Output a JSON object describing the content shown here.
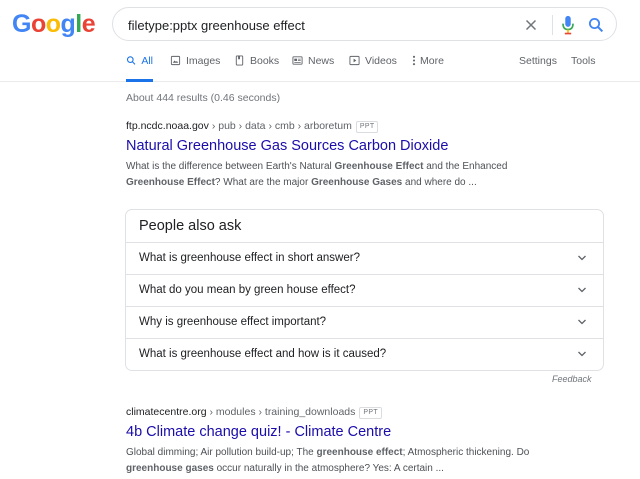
{
  "logo": {
    "text": "Google"
  },
  "search": {
    "query": "filetype:pptx greenhouse effect"
  },
  "tabs": [
    {
      "label": "All",
      "icon": "search-icon"
    },
    {
      "label": "Images",
      "icon": "image-icon"
    },
    {
      "label": "Books",
      "icon": "book-icon"
    },
    {
      "label": "News",
      "icon": "newspaper-icon"
    },
    {
      "label": "Videos",
      "icon": "video-icon"
    },
    {
      "label": "More",
      "icon": "more-vert-icon"
    }
  ],
  "tools": {
    "settings": "Settings",
    "tools": "Tools"
  },
  "stats": "About 444 results (0.46 seconds)",
  "results": [
    {
      "site": "ftp.ncdc.noaa.gov",
      "path": " › pub › data › cmb › arboretum",
      "badge": "PPT",
      "title": "Natural Greenhouse Gas Sources Carbon Dioxide",
      "snippet": [
        "What is the difference between Earth's Natural ",
        "Greenhouse Effect",
        " and the Enhanced ",
        "Greenhouse Effect",
        "? What are the major ",
        "Greenhouse Gases",
        " and where do ..."
      ]
    },
    {
      "site": "climatecentre.org",
      "path": " › modules › training_downloads",
      "badge": "PPT",
      "title": "4b Climate change quiz! - Climate Centre",
      "snippet": [
        "Global dimming; Air pollution build-up; The ",
        "greenhouse effect",
        "; Atmospheric thickening. Do ",
        "greenhouse gases",
        " occur naturally in the atmosphere? Yes: A certain ..."
      ]
    }
  ],
  "paa": {
    "title": "People also ask",
    "questions": [
      "What is greenhouse effect in short answer?",
      "What do you mean by green house effect?",
      "Why is greenhouse effect important?",
      "What is greenhouse effect and how is it caused?"
    ],
    "feedback": "Feedback"
  },
  "colors": {
    "link": "#1a0dab",
    "accent": "#1a73e8",
    "logo_blue": "#4285f4",
    "logo_red": "#ea4335",
    "logo_yellow": "#fbbc05",
    "logo_green": "#34a853"
  }
}
